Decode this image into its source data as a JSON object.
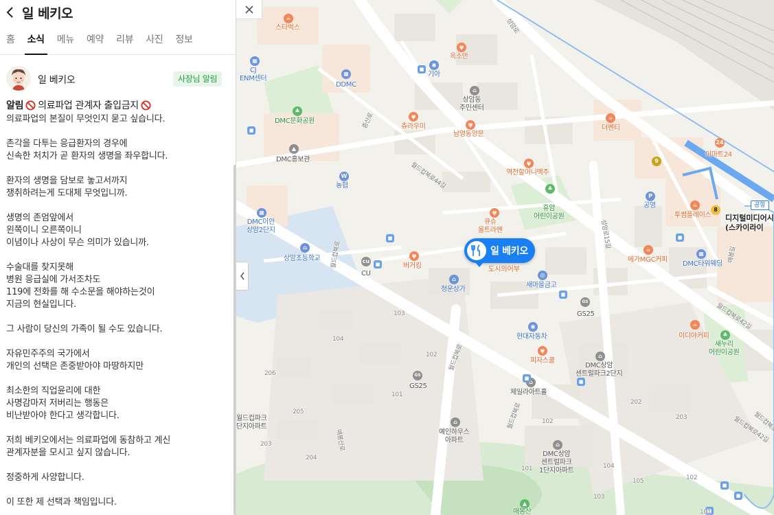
{
  "panel": {
    "title": "일 베키오",
    "tabs": [
      {
        "label": "홈",
        "active": false
      },
      {
        "label": "소식",
        "active": true
      },
      {
        "label": "메뉴",
        "active": false
      },
      {
        "label": "예약",
        "active": false
      },
      {
        "label": "리뷰",
        "active": false
      },
      {
        "label": "사진",
        "active": false
      },
      {
        "label": "정보",
        "active": false
      }
    ],
    "post": {
      "author": "일 베키오",
      "badge": "사장님 알림",
      "title_prefix": "알림",
      "title_text": "의료파업 관계자 출입금지",
      "paragraphs": [
        "의료파업의 본질이 무엇인지 묻고 싶습니다.",
        "촌각을 다투는 응급환자의 경우에\n신속한 처치가 곧 환자의 생명을 좌우합니다.",
        "환자의 생명을 담보로 놓고서까지\n쟁취하려는게 도대체 무엇입니까.",
        "생명의 존엄앞에서\n왼쪽이니 오른쪽이니\n이념이나 사상이 무슨 의미가 있습니까.",
        "수술대를 찾지못해\n병원 응급실에 가서조차도\n119에 전화를 해 수소문을 해야하는것이\n지금의 현실입니다.",
        "그 사람이 당신의 가족이 될 수도 있습니다.",
        "자유민주주의 국가에서\n개인의 선택은 존중받아야 마땅하지만",
        "최소한의 직업윤리에 대한\n사명감마저 저버리는 행동은\n비난받아야 한다고 생각합니다.",
        "저희 베키오에서는 의료파업에 동참하고 계신\n관계자분을 모시고 싶지 않습니다.",
        "정중하게 사양합니다.",
        "이 또한 제 선택과 책임입니다."
      ]
    }
  },
  "map": {
    "marker": {
      "label": "일 베키오",
      "sub": "도시의어부"
    },
    "station": {
      "sign": "공항",
      "name_line1": "디지털미디어시",
      "name_line2": "(스카이라이"
    },
    "pois": [
      {
        "name": "스타벅스",
        "color": "orange"
      },
      {
        "name": "CJ\nENM센터",
        "color": "blue"
      },
      {
        "name": "DDMC",
        "color": "blue"
      },
      {
        "name": "옥소반",
        "color": "orange"
      },
      {
        "name": "기아",
        "color": "blue"
      },
      {
        "name": "상암동\n주민센터",
        "color": "gray"
      },
      {
        "name": "DMC문화공원",
        "color": "green"
      },
      {
        "name": "츄라우미",
        "color": "orange"
      },
      {
        "name": "남영동양문",
        "color": "orange"
      },
      {
        "name": "더벤티",
        "color": "orange"
      },
      {
        "name": "이마트24",
        "color": "orange"
      },
      {
        "name": "DMC홍보관",
        "color": "gray"
      },
      {
        "name": "역전할머니맥주",
        "color": "orange"
      },
      {
        "name": "농협",
        "color": "blue"
      },
      {
        "name": "휴암\n어린이공원",
        "color": "green"
      },
      {
        "name": "공영",
        "color": "blue"
      },
      {
        "name": "투썸플레이스",
        "color": "orange"
      },
      {
        "name": "DMC이안\n상암2단지",
        "color": "blue"
      },
      {
        "name": "큐슈\n울트라멘",
        "color": "orange"
      },
      {
        "name": "상암초등학교",
        "color": "blue"
      },
      {
        "name": "버거킹",
        "color": "orange"
      },
      {
        "name": "CU",
        "color": "gray"
      },
      {
        "name": "메가MGC커피",
        "color": "orange"
      },
      {
        "name": "DMC타워웨딩",
        "color": "blue"
      },
      {
        "name": "새마을금고",
        "color": "blue"
      },
      {
        "name": "청운상가",
        "color": "blue"
      },
      {
        "name": "GS25",
        "color": "gray"
      },
      {
        "name": "현대자동차",
        "color": "blue"
      },
      {
        "name": "이디야커피",
        "color": "orange"
      },
      {
        "name": "새누리\n어린이공원",
        "color": "green"
      },
      {
        "name": "피자스쿨",
        "color": "orange"
      },
      {
        "name": "DMC상암\n센트럴파크2단지",
        "color": "gray"
      },
      {
        "name": "제일라아트홀",
        "color": "gray"
      },
      {
        "name": "GS25",
        "color": "gray"
      },
      {
        "name": "월드컵파크\n단지아파트",
        "color": "gray"
      },
      {
        "name": "예인하우스\n아파트",
        "color": "gray"
      },
      {
        "name": "DMC상암\n센트럴파크\n1단지아파트",
        "color": "gray"
      },
      {
        "name": "매봉산",
        "color": "green"
      }
    ],
    "roads": [
      "성암로",
      "월드컵북로44길",
      "월드컵북로42길",
      "월드컵북로42길",
      "성암로15길",
      "월드컵북로",
      "월드컵북로",
      "매봉산로",
      "월드컵북로",
      "증산로",
      "매봉길",
      "월드컵북로42길"
    ],
    "numbers": [
      "103",
      "104",
      "102",
      "206",
      "101",
      "205",
      "203",
      "204",
      "202",
      "203",
      "102",
      "101",
      "104",
      "105",
      "103",
      "102",
      "101"
    ],
    "subway_lines": [
      "9",
      "8"
    ]
  }
}
